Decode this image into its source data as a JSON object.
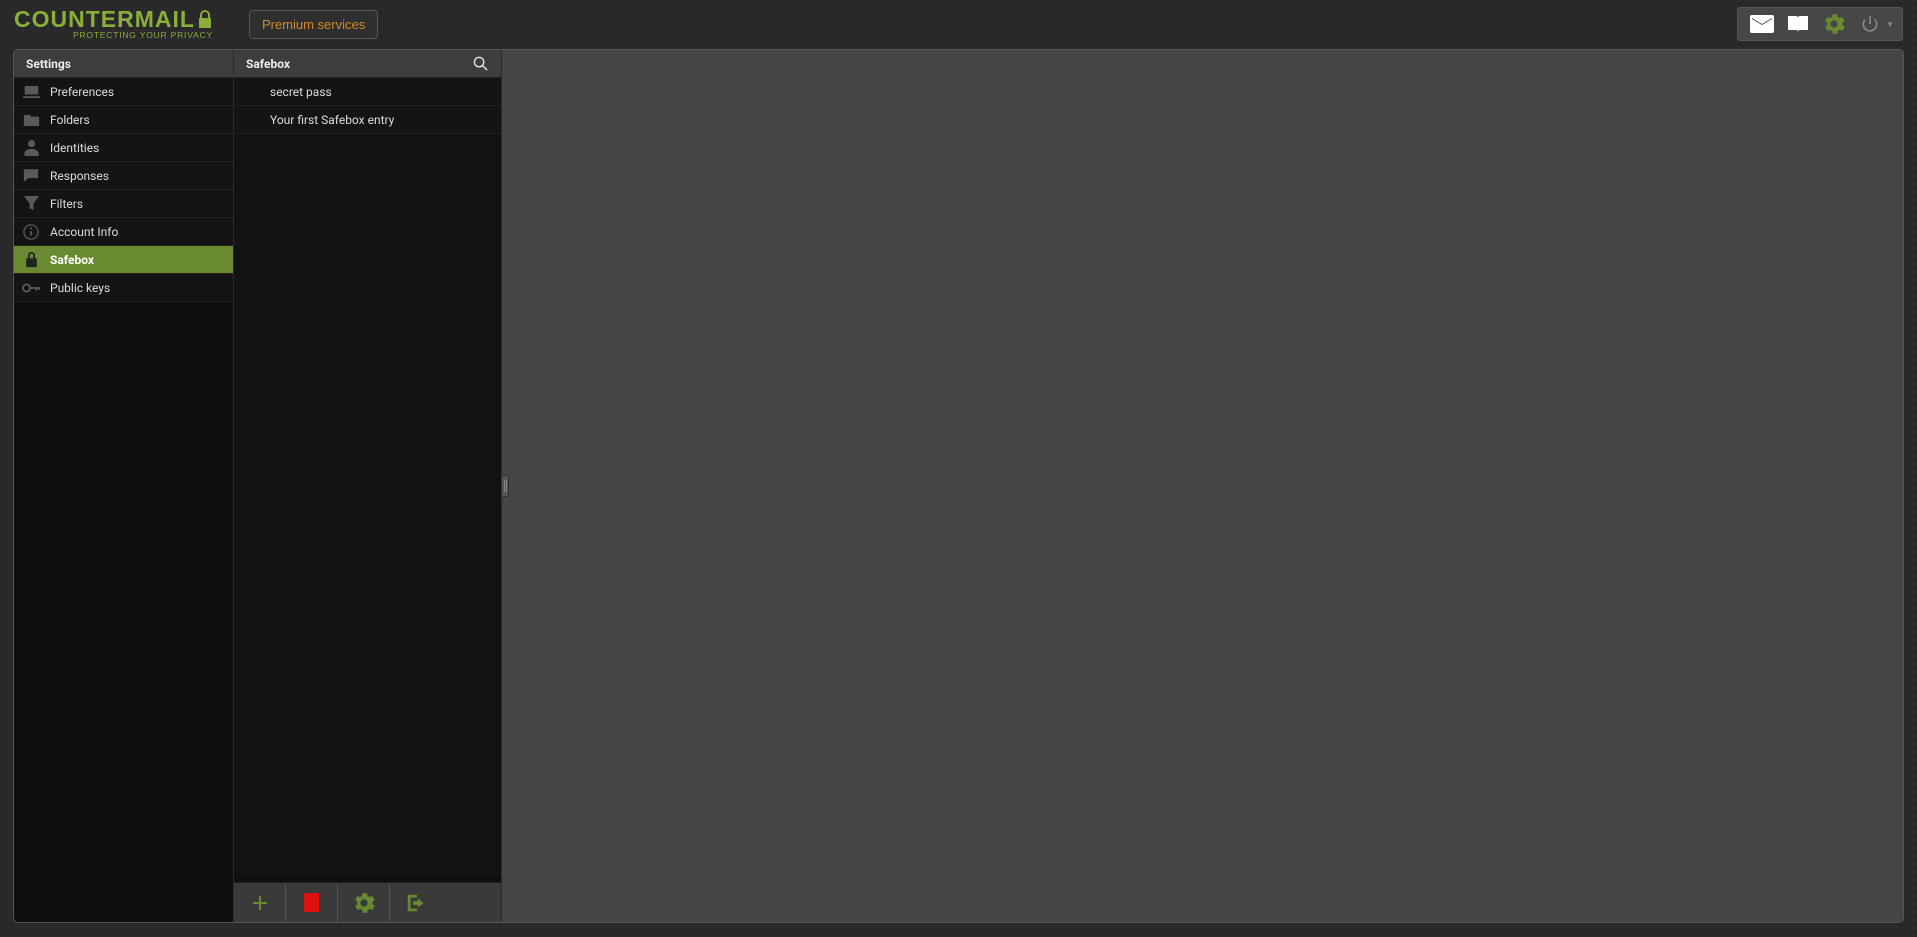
{
  "logo": {
    "main": "COUNTERMAIL",
    "sub": "PROTECTING YOUR PRIVACY"
  },
  "header": {
    "premium_label": "Premium services"
  },
  "sidebar": {
    "title": "Settings",
    "items": [
      {
        "label": "Preferences",
        "icon": "laptop"
      },
      {
        "label": "Folders",
        "icon": "folder"
      },
      {
        "label": "Identities",
        "icon": "person"
      },
      {
        "label": "Responses",
        "icon": "chat"
      },
      {
        "label": "Filters",
        "icon": "filter"
      },
      {
        "label": "Account Info",
        "icon": "info"
      },
      {
        "label": "Safebox",
        "icon": "lock",
        "selected": true
      },
      {
        "label": "Public keys",
        "icon": "key"
      }
    ]
  },
  "midcol": {
    "title": "Safebox",
    "items": [
      {
        "label": "secret pass"
      },
      {
        "label": "Your first Safebox entry"
      }
    ]
  }
}
